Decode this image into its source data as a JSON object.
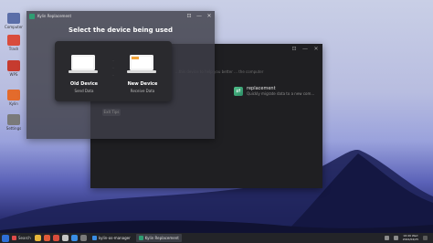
{
  "desktop": {
    "icons": [
      {
        "label": "Computer",
        "icon": "computer-icon",
        "color": "#5b6ea8"
      },
      {
        "label": "Trash",
        "icon": "trash-icon",
        "color": "#d94c3c"
      },
      {
        "label": "WPS",
        "icon": "wps-icon",
        "color": "#c63b2f"
      },
      {
        "label": "Kylin",
        "icon": "kylin-icon",
        "color": "#e36b2c"
      },
      {
        "label": "Recycle",
        "icon": "recycle-icon",
        "color": "#555"
      },
      {
        "label": "Settings",
        "icon": "settings-icon",
        "color": "#7a7a7a"
      }
    ]
  },
  "window_front": {
    "title": "Kylin Replacement",
    "heading": "Select the device being used",
    "back_button": "Exit Tips",
    "controls": [
      "⊡",
      "—",
      "✕"
    ]
  },
  "device_panel": {
    "old": {
      "title": "Old Device",
      "subtitle": "Send Data",
      "icon": "laptop-icon"
    },
    "new": {
      "title": "New Device",
      "subtitle": "Receive Data",
      "icon": "laptop-icon"
    }
  },
  "window_back": {
    "hint": "...this device to help you better ... the computer",
    "replace_title": "replacement",
    "replace_desc": "Quickly migrate data to a new com...",
    "controls": [
      "⊡",
      "—",
      "✕"
    ]
  },
  "taskbar": {
    "search_label": "Search",
    "tasks": [
      {
        "label": "kylin-os-manager",
        "icon": "kylin-manager-icon",
        "active": false
      },
      {
        "label": "Kylin Replacement",
        "icon": "kylin-replacement-icon",
        "active": true
      }
    ],
    "time": "16:49 Wed",
    "date": "2024/04/25"
  },
  "colors": {
    "accent": "#2f9d73",
    "new_device_flag": "#f0a33a",
    "window_dark": "#1f1f22",
    "panel": "#2a2a2e"
  }
}
